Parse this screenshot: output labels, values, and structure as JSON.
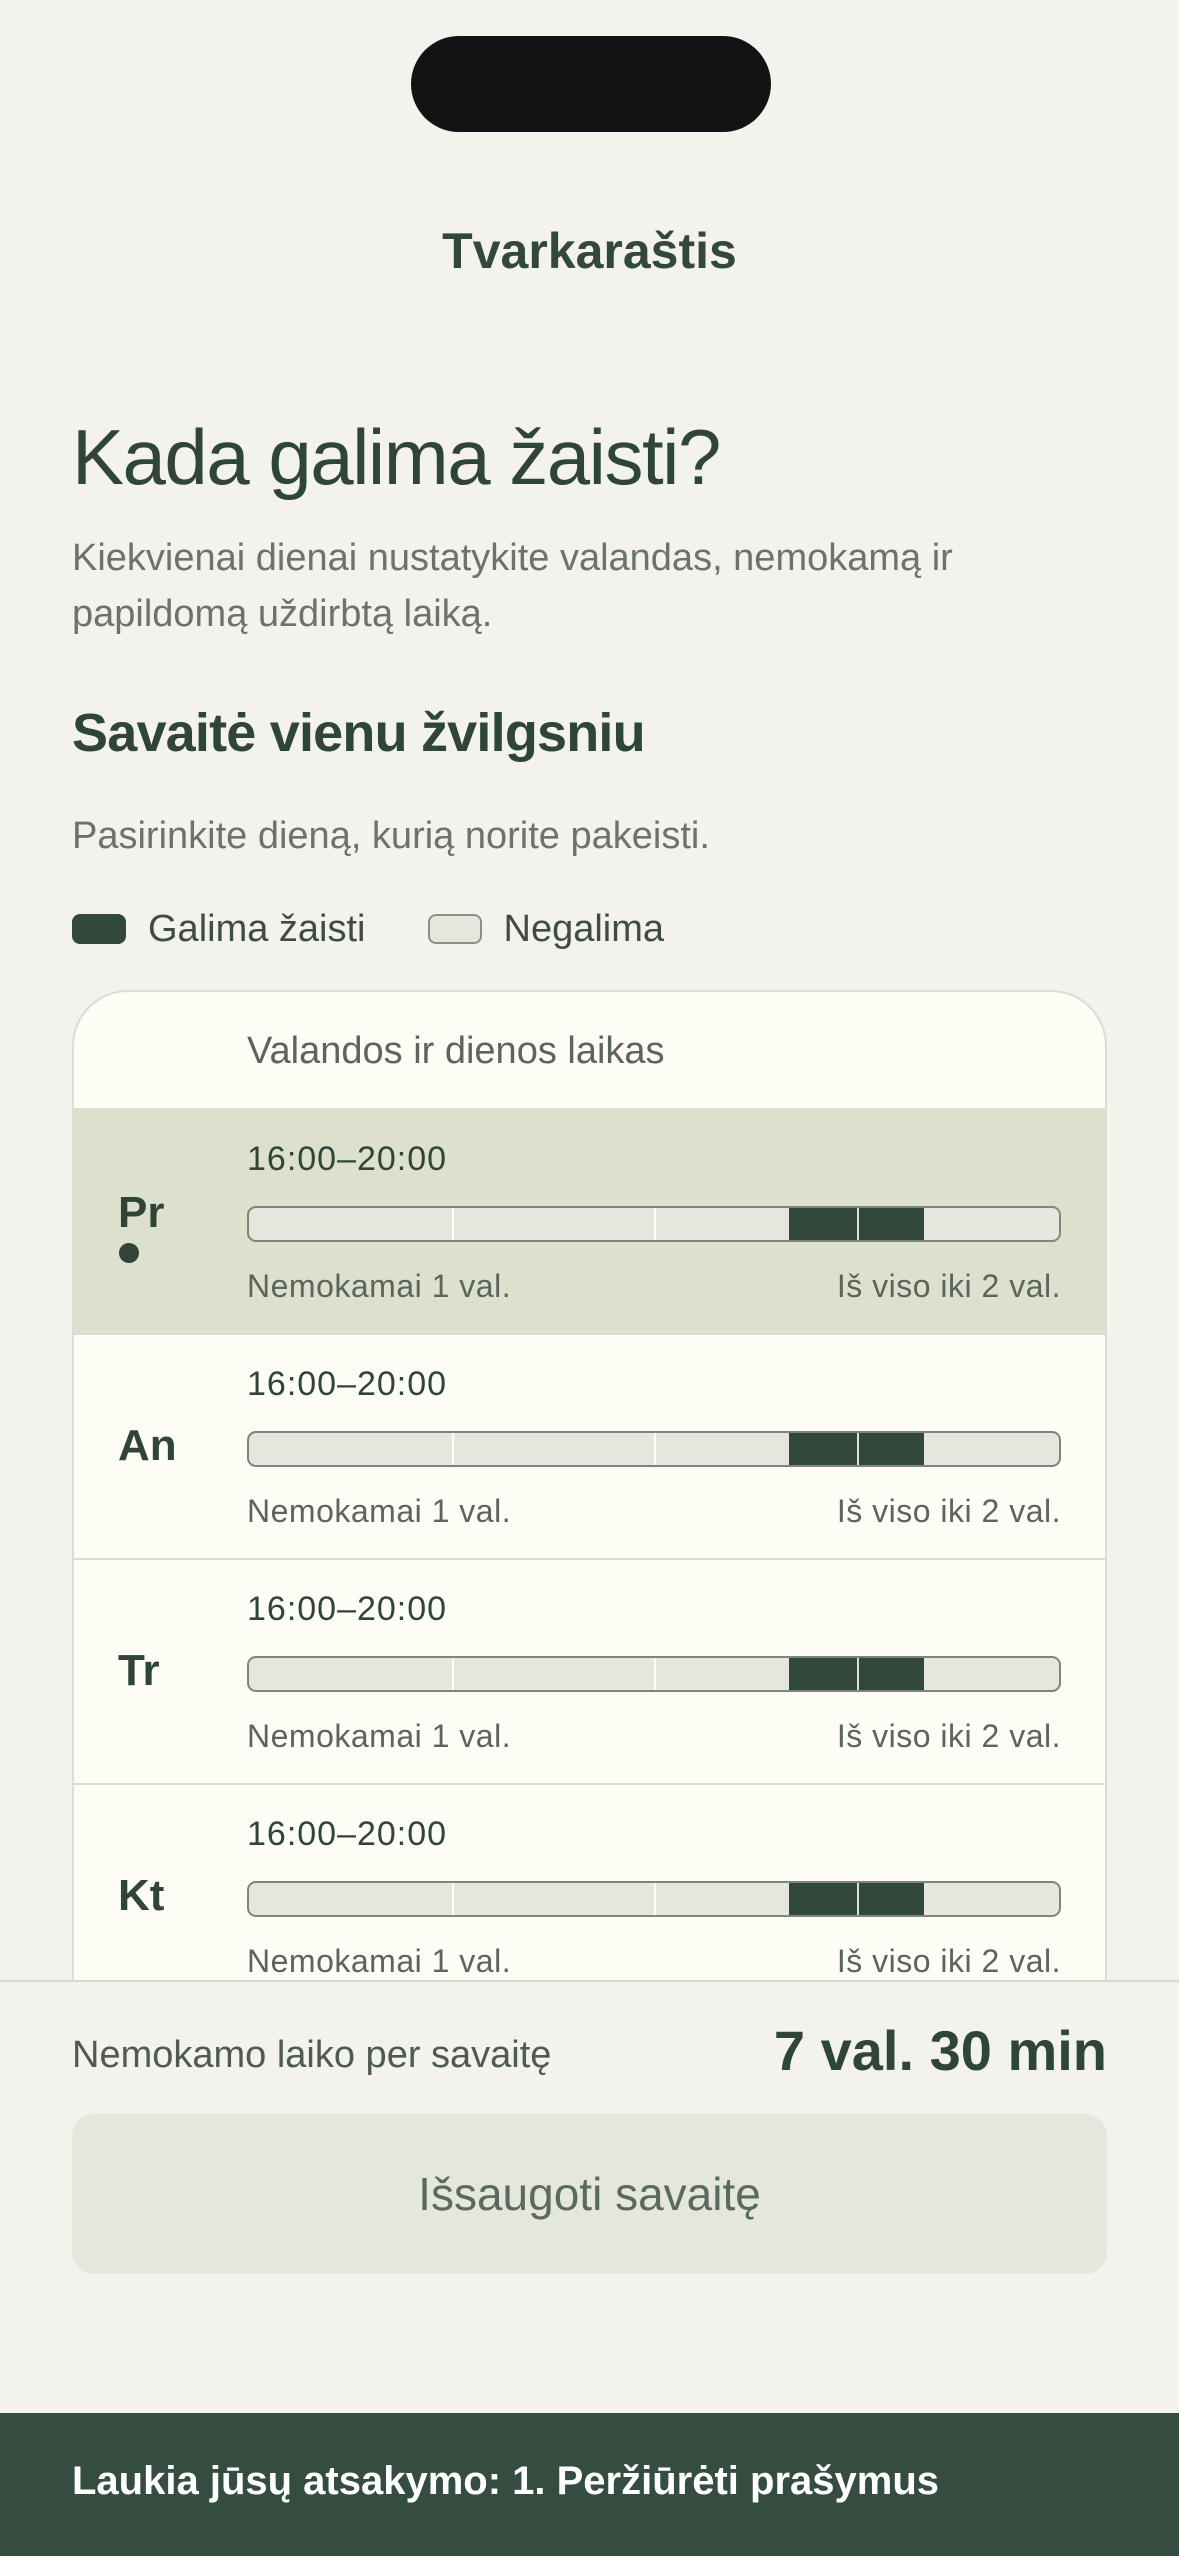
{
  "nav": {
    "title": "Tvarkaraštis"
  },
  "header": {
    "heading": "Kada galima žaisti?",
    "subtitle": "Kiekvienai dienai nustatykite valandas, nemokamą ir papildomą uždirbtą laiką."
  },
  "week": {
    "heading": "Savaitė vienu žvilgsniu",
    "hint": "Pasirinkite dieną, kurią norite pakeisti.",
    "legend": {
      "available": "Galima žaisti",
      "unavailable": "Negalima"
    },
    "table_header": "Valandos ir dienos laikas",
    "days": [
      {
        "label": "Pr",
        "time": "16:00–20:00",
        "free": "Nemokamai 1 val.",
        "total": "Iš viso iki 2 val.",
        "selected": true,
        "available_start": 0.667,
        "available_end": 0.833
      },
      {
        "label": "An",
        "time": "16:00–20:00",
        "free": "Nemokamai 1 val.",
        "total": "Iš viso iki 2 val.",
        "selected": false,
        "available_start": 0.667,
        "available_end": 0.833
      },
      {
        "label": "Tr",
        "time": "16:00–20:00",
        "free": "Nemokamai 1 val.",
        "total": "Iš viso iki 2 val.",
        "selected": false,
        "available_start": 0.667,
        "available_end": 0.833
      },
      {
        "label": "Kt",
        "time": "16:00–20:00",
        "free": "Nemokamai 1 val.",
        "total": "Iš viso iki 2 val.",
        "selected": false,
        "available_start": 0.667,
        "available_end": 0.833
      }
    ]
  },
  "summary": {
    "label": "Nemokamo laiko per savaitę",
    "value": "7 val. 30 min"
  },
  "save_button": {
    "label": "Išsaugoti savaitę"
  },
  "banner": {
    "text": "Laukia jūsų atsakymo: 1. Peržiūrėti prašymus"
  },
  "colors": {
    "accent": "#33483d",
    "selected_row": "#dce0cc",
    "track": "#e6e7dc",
    "banner": "#344d40"
  }
}
